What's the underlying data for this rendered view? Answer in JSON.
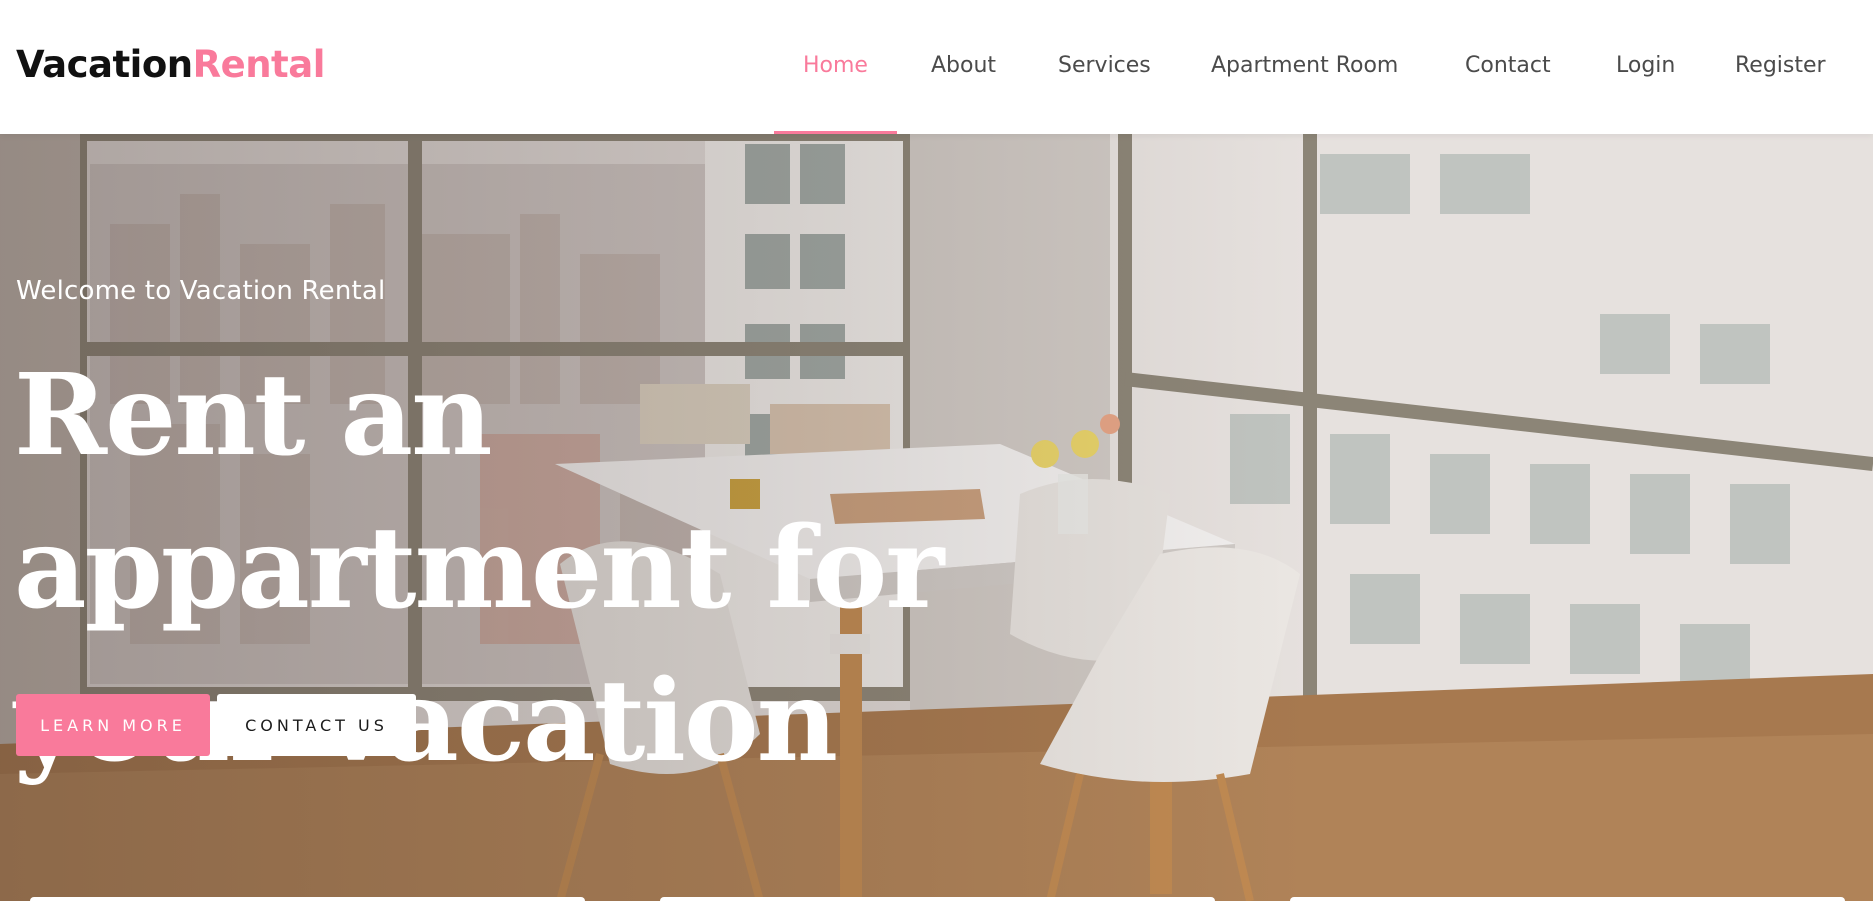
{
  "brand": {
    "part1": "Vacation",
    "part2": "Rental"
  },
  "nav": {
    "home": "Home",
    "about": "About",
    "services": "Services",
    "apartment": "Apartment Room",
    "contact": "Contact",
    "login": "Login",
    "register": "Register"
  },
  "hero": {
    "welcome": "Welcome to Vacation Rental",
    "headline_lines": [
      "Rent an",
      "appartment for",
      "your vacation"
    ],
    "learn_more": "LEARN MORE",
    "contact_us": "CONTACT US"
  },
  "colors": {
    "accent": "#f97a9b",
    "text_dark": "#111111",
    "nav_text": "#4b4b4b"
  }
}
